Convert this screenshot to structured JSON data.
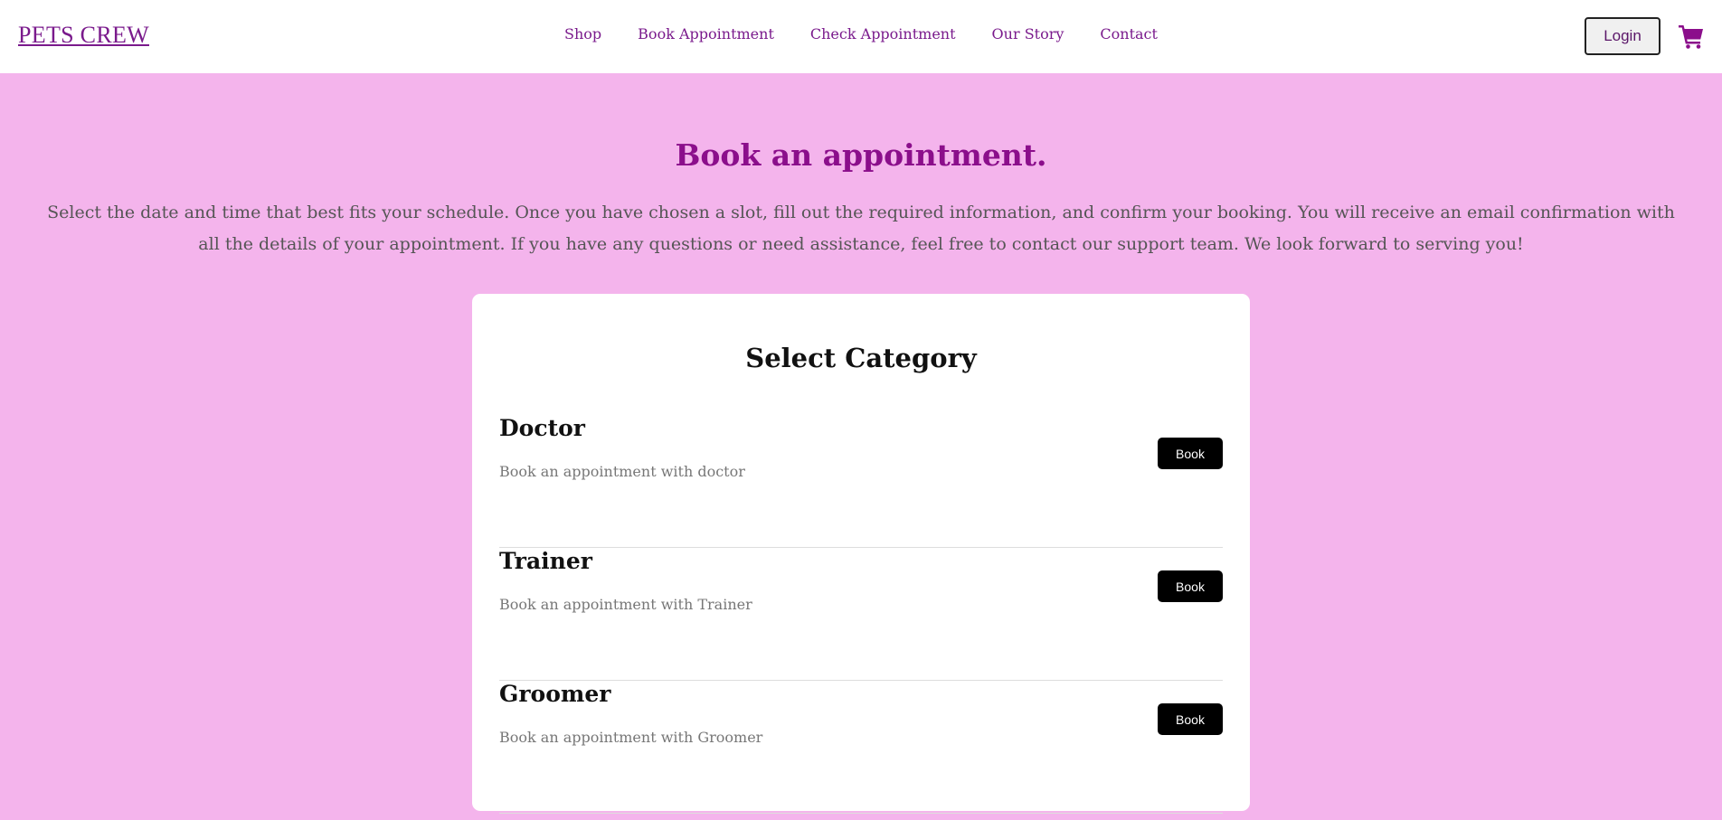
{
  "header": {
    "brand": "PETS CREW",
    "nav": [
      "Shop",
      "Book Appointment",
      "Check Appointment",
      "Our Story",
      "Contact"
    ],
    "login_label": "Login",
    "cart_icon": "shopping-cart-icon"
  },
  "intro": {
    "title": "Book an appointment.",
    "text": "Select the date and time that best fits your schedule. Once you have chosen a slot, fill out the required information, and confirm your booking. You will receive an email confirmation with all the details of your appointment. If you have any questions or need assistance, feel free to contact our support team. We look forward to serving you!"
  },
  "card": {
    "title": "Select Category",
    "categories": [
      {
        "name": "Doctor",
        "description": "Book an appointment with doctor",
        "button": "Book"
      },
      {
        "name": "Trainer",
        "description": "Book an appointment with Trainer",
        "button": "Book"
      },
      {
        "name": "Groomer",
        "description": "Book an appointment with Groomer",
        "button": "Book"
      }
    ]
  },
  "colors": {
    "page_bg": "#f4b4ec",
    "accent": "#8b0e8b",
    "button_bg": "#000000"
  }
}
